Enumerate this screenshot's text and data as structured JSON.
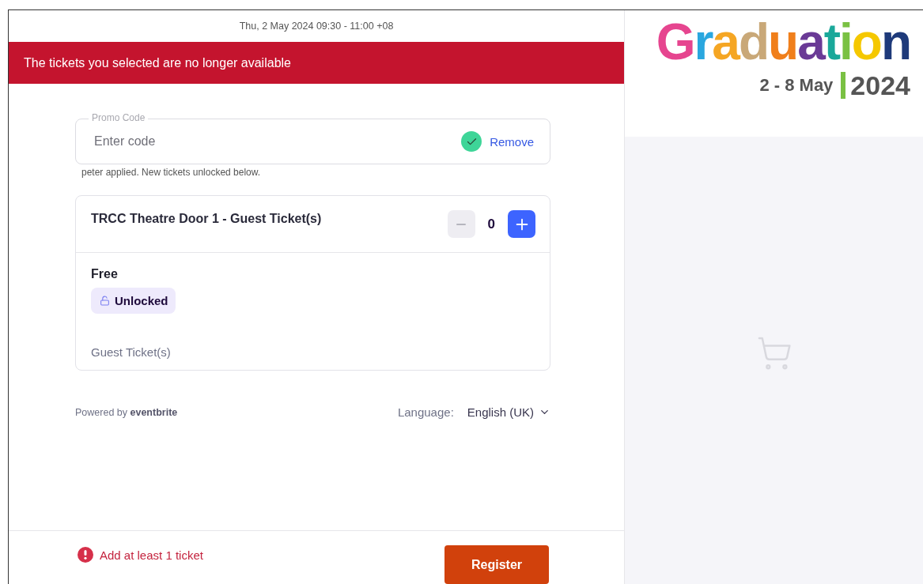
{
  "event_time": "Thu, 2 May 2024 09:30 - 11:00 +08",
  "alert": "The tickets you selected are no longer available",
  "promo": {
    "label": "Promo Code",
    "placeholder": "Enter code",
    "applied": true,
    "action": "Remove",
    "message": "peter applied. New tickets unlocked below."
  },
  "tickets": [
    {
      "name": "TRCC Theatre Door 1 - Guest Ticket(s)",
      "quantity": "0",
      "minus_disabled": true,
      "price": "Free",
      "badge": "Unlocked",
      "description": "Guest Ticket(s)"
    }
  ],
  "footer": {
    "powered_by": "Powered by",
    "brand": "eventbrite",
    "language_label": "Language:",
    "language": "English (UK)"
  },
  "checkout": {
    "error": "Add at least 1 ticket",
    "button": "Register"
  },
  "logo": {
    "title": "Graduation",
    "dates": "2 - 8 May",
    "year": "2024"
  }
}
